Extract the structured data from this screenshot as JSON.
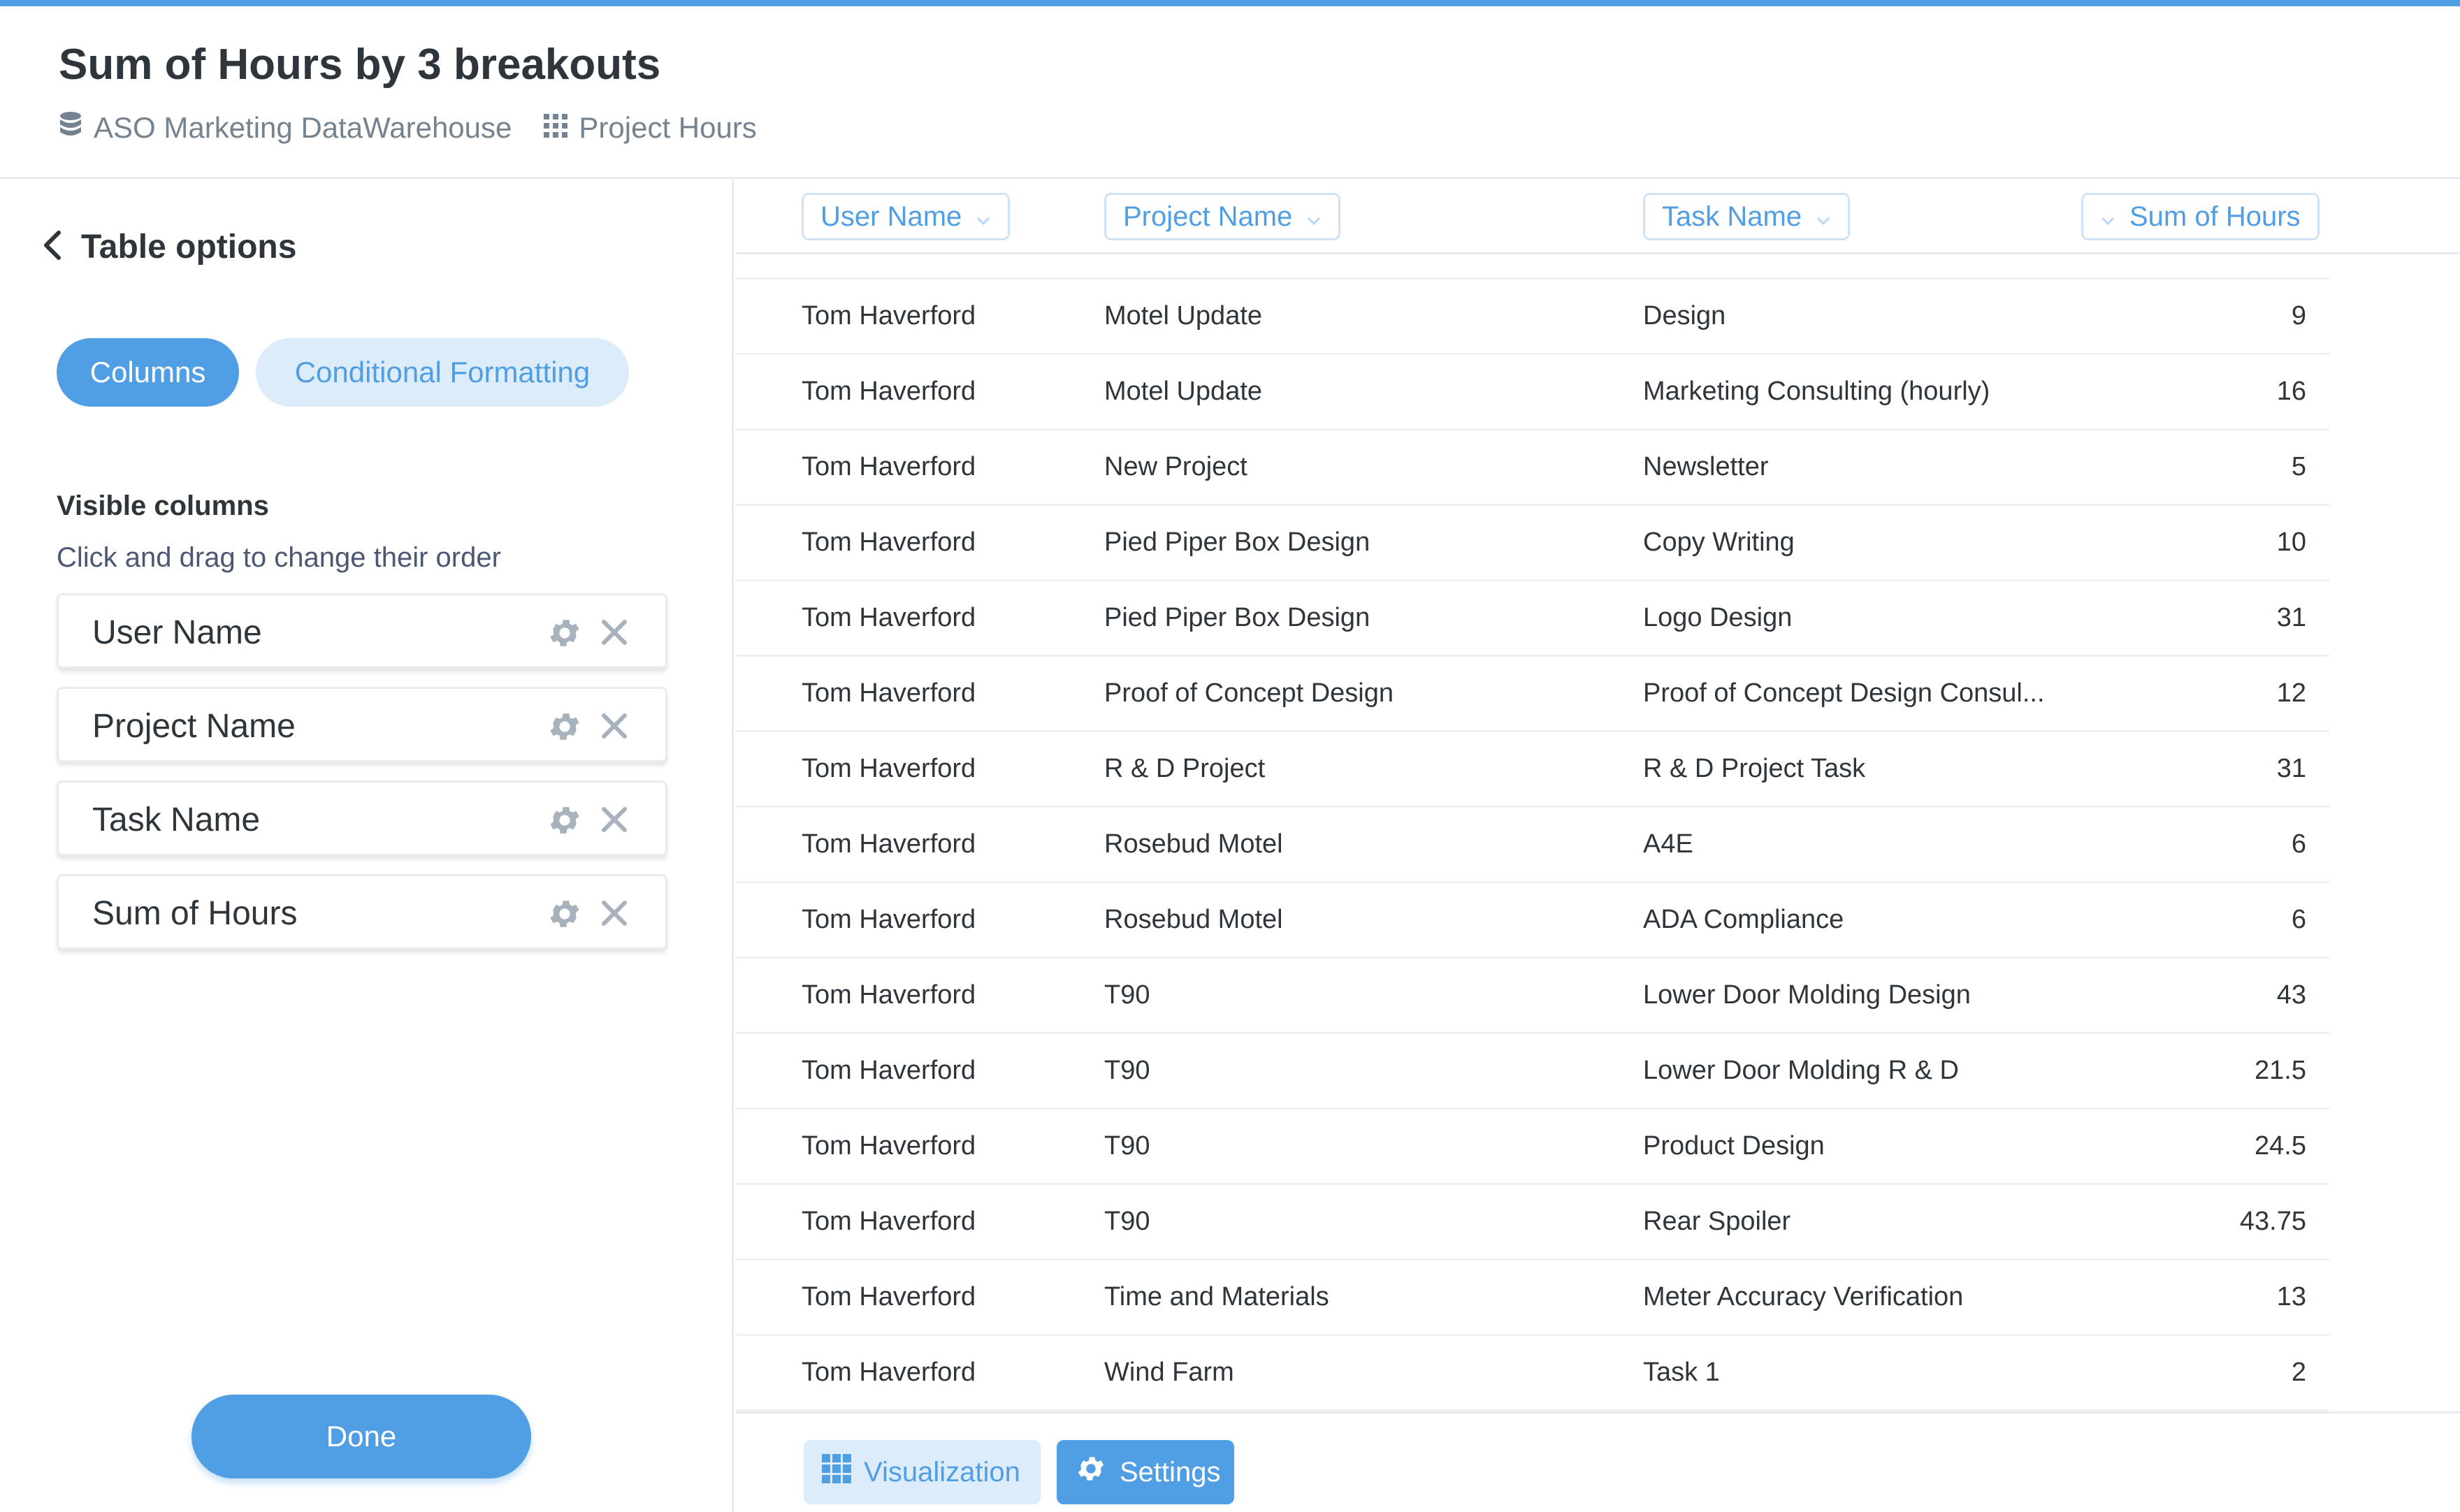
{
  "colors": {
    "accent": "#509ee3",
    "accent_light": "#ddecfa",
    "text": "#2e353b",
    "muted": "#74838f",
    "border": "#e8ecef"
  },
  "header": {
    "title": "Sum of Hours by 3 breakouts",
    "breadcrumbs": [
      {
        "icon": "database-icon",
        "label": "ASO Marketing DataWarehouse"
      },
      {
        "icon": "table-grid-icon",
        "label": "Project Hours"
      }
    ]
  },
  "sidebar": {
    "back_label": "Table options",
    "tabs": [
      {
        "label": "Columns",
        "active": true
      },
      {
        "label": "Conditional Formatting",
        "active": false
      }
    ],
    "visible_columns_title": "Visible columns",
    "visible_columns_hint": "Click and drag to change their order",
    "columns": [
      {
        "label": "User Name"
      },
      {
        "label": "Project Name"
      },
      {
        "label": "Task Name"
      },
      {
        "label": "Sum of Hours"
      }
    ],
    "done_label": "Done"
  },
  "table": {
    "headers": [
      "User Name",
      "Project Name",
      "Task Name",
      "Sum of Hours"
    ],
    "rows": [
      [
        "Tom Haverford",
        "Motel Update",
        "Design",
        "9"
      ],
      [
        "Tom Haverford",
        "Motel Update",
        "Marketing Consulting (hourly)",
        "16"
      ],
      [
        "Tom Haverford",
        "New Project",
        "Newsletter",
        "5"
      ],
      [
        "Tom Haverford",
        "Pied Piper Box Design",
        "Copy Writing",
        "10"
      ],
      [
        "Tom Haverford",
        "Pied Piper Box Design",
        "Logo Design",
        "31"
      ],
      [
        "Tom Haverford",
        "Proof of Concept Design",
        "Proof of Concept Design Consul...",
        "12"
      ],
      [
        "Tom Haverford",
        "R & D Project",
        "R & D Project Task",
        "31"
      ],
      [
        "Tom Haverford",
        "Rosebud Motel",
        "A4E",
        "6"
      ],
      [
        "Tom Haverford",
        "Rosebud Motel",
        "ADA Compliance",
        "6"
      ],
      [
        "Tom Haverford",
        "T90",
        "Lower Door Molding Design",
        "43"
      ],
      [
        "Tom Haverford",
        "T90",
        "Lower Door Molding R & D",
        "21.5"
      ],
      [
        "Tom Haverford",
        "T90",
        "Product Design",
        "24.5"
      ],
      [
        "Tom Haverford",
        "T90",
        "Rear Spoiler",
        "43.75"
      ],
      [
        "Tom Haverford",
        "Time and Materials",
        "Meter Accuracy Verification",
        "13"
      ],
      [
        "Tom Haverford",
        "Wind Farm",
        "Task 1",
        "2"
      ]
    ]
  },
  "footer": {
    "visualization_label": "Visualization",
    "settings_label": "Settings"
  }
}
